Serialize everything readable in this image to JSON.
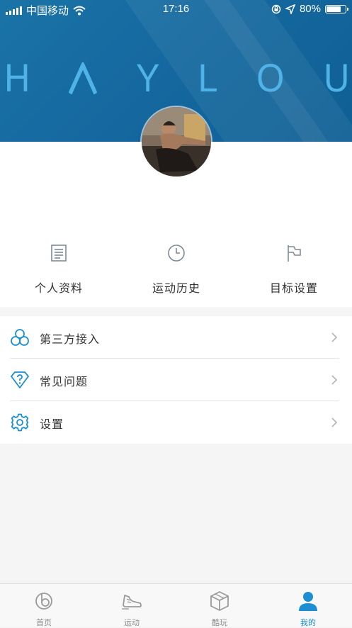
{
  "status_bar": {
    "carrier": "中国移动",
    "time": "17:16",
    "battery": "80%",
    "battery_level": 0.8
  },
  "header": {
    "brand_letters": [
      "H",
      "A",
      "Y",
      "L",
      "O",
      "U"
    ]
  },
  "quick_actions": [
    {
      "label": "个人资料",
      "icon": "document-icon"
    },
    {
      "label": "运动历史",
      "icon": "clock-icon"
    },
    {
      "label": "目标设置",
      "icon": "flag-icon"
    }
  ],
  "menu": [
    {
      "label": "第三方接入",
      "icon": "cloud-link-icon"
    },
    {
      "label": "常见问题",
      "icon": "question-diamond-icon"
    },
    {
      "label": "设置",
      "icon": "gear-icon"
    }
  ],
  "tabs": [
    {
      "label": "首页",
      "icon": "home-icon"
    },
    {
      "label": "运动",
      "icon": "shoe-icon"
    },
    {
      "label": "酷玩",
      "icon": "cube-icon"
    },
    {
      "label": "我的",
      "icon": "user-icon",
      "active": true
    }
  ],
  "colors": {
    "header_blue": "#1569a0",
    "brand_light_blue": "#4fb3e8",
    "menu_icon_blue": "#1c8fd3",
    "tab_active": "#1c8fd3"
  }
}
